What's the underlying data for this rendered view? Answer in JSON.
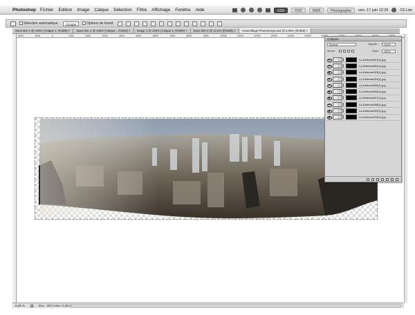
{
  "menubar": {
    "app_name": "Photoshop",
    "items": [
      "Fichier",
      "Edition",
      "Image",
      "Calque",
      "Sélection",
      "Filtre",
      "Affichage",
      "Fenêtre",
      "Aide"
    ],
    "workspace_buttons": [
      "ESS",
      "DVD",
      "WEB",
      "Photographie"
    ],
    "active_workspace_index": 0,
    "clock": "ven. 17 juin  12:25",
    "cs_live": "CS Live"
  },
  "options_bar": {
    "auto_select_label": "Sélection automatique :",
    "auto_select_value": "Groupe",
    "transform_controls_label": "Options de transf."
  },
  "tabs": [
    {
      "label": "Sans titre-1 @ 100% (Calque 1, RVB/8) ×",
      "active": false
    },
    {
      "label": "Sans titre-1 @ 100% (Calque... RVB/8) ×",
      "active": false
    },
    {
      "label": "Image 1 @ 100% (Calque 1, RVB/8) ×",
      "active": false
    },
    {
      "label": "Sans titre-2 @ 12,5% (RVB/8) ×",
      "active": false
    },
    {
      "label": "Assemblage-Photomerge.psd @ 6,25% (RVB/8) ×",
      "active": true
    }
  ],
  "ruler": {
    "ticks": [
      "2000",
      "1000",
      "0",
      "1000",
      "2000",
      "3000",
      "4000",
      "5000",
      "6000",
      "7000",
      "8000",
      "9000",
      "10000",
      "11000",
      "12000",
      "13000",
      "14000",
      "15000",
      "16000",
      "17000",
      "18000",
      "19000",
      "20000"
    ]
  },
  "layers_panel": {
    "title": "Calques",
    "blend_mode": "Normal",
    "opacity_label": "Opacité :",
    "opacity_value": "100%",
    "lock_label": "Verrou :",
    "fill_label": "Fond :",
    "fill_value": "100%",
    "layers": [
      {
        "name": "La-Defense001(1).jpg",
        "selected": false
      },
      {
        "name": "La-Defense002(1).jpg",
        "selected": false
      },
      {
        "name": "La-Defense003(1).jpg",
        "selected": false
      },
      {
        "name": "La-Defense004(1).jpg",
        "selected": false
      },
      {
        "name": "La-Defense005(1).jpg",
        "selected": false
      },
      {
        "name": "La-Defense006(1).jpg",
        "selected": false
      },
      {
        "name": "La-Defense007(1).jpg",
        "selected": false
      },
      {
        "name": "La-Defense008(1).jpg",
        "selected": false
      },
      {
        "name": "La-Defense009(1).jpg",
        "selected": false
      },
      {
        "name": "La-Defense010(1).jpg",
        "selected": false
      }
    ]
  },
  "status": {
    "zoom": "6,25 %",
    "doc_info": "Doc : 307,0 Mo / 1,56 Go"
  },
  "colors": {
    "menubar": "#e6e6e6",
    "panel": "#d6d6d6",
    "canvas": "#ffffff",
    "mask": "#050505"
  }
}
